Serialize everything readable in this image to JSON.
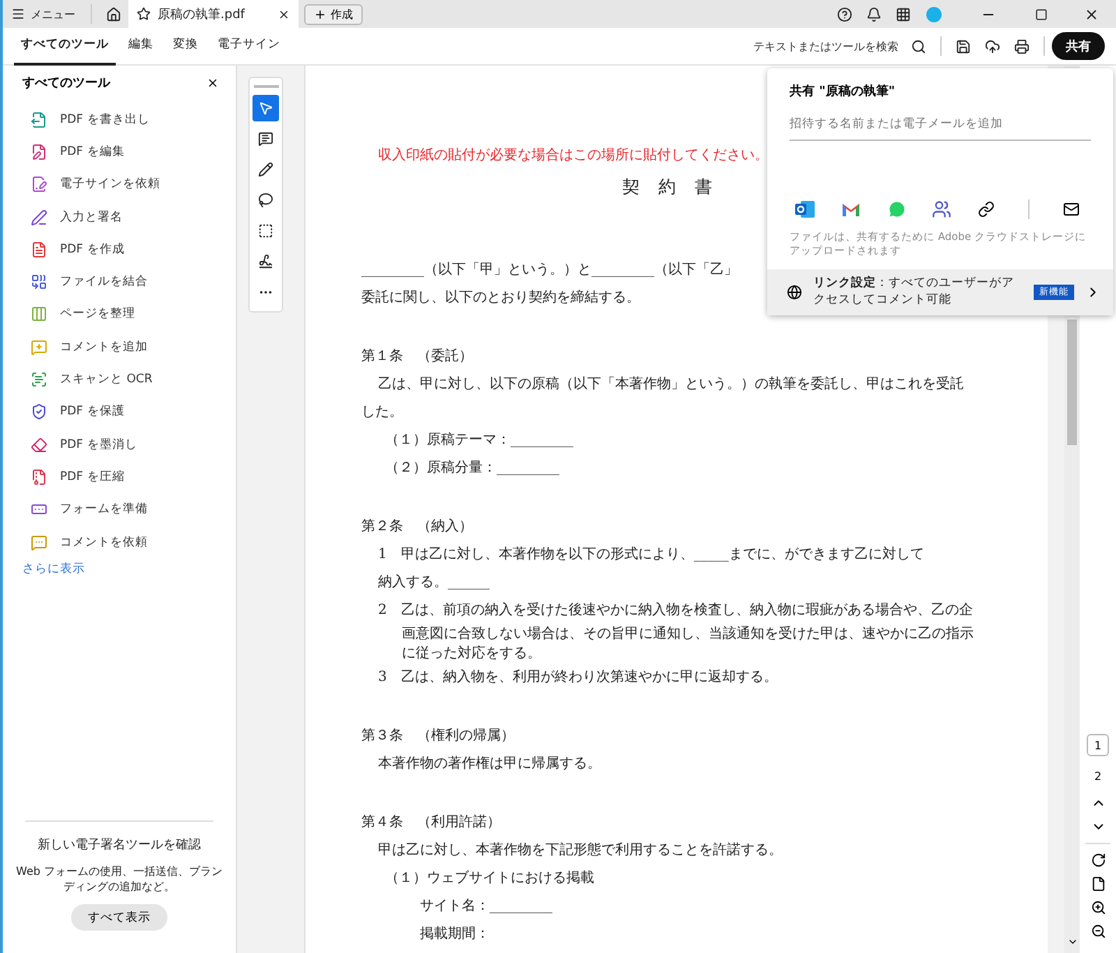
{
  "titlebar": {
    "menu": "メニュー",
    "tab": {
      "title": "原稿の執筆.pdf"
    },
    "create": "作成"
  },
  "toolbar": {
    "tabs": [
      {
        "label": "すべてのツール",
        "selected": true
      },
      {
        "label": "編集",
        "selected": false
      },
      {
        "label": "変換",
        "selected": false
      },
      {
        "label": "電子サイン",
        "selected": false
      }
    ],
    "search": "テキストまたはツールを検索",
    "share": "共有"
  },
  "sidebar": {
    "title": "すべてのツール",
    "items": [
      {
        "label": "PDF を書き出し",
        "color": "#1a9a8f"
      },
      {
        "label": "PDF を編集",
        "color": "#d0337a"
      },
      {
        "label": "電子サインを依頼",
        "color": "#b04ad0"
      },
      {
        "label": "入力と署名",
        "color": "#7a45d8"
      },
      {
        "label": "PDF を作成",
        "color": "#e03a3a"
      },
      {
        "label": "ファイルを結合",
        "color": "#4b5ee0"
      },
      {
        "label": "ページを整理",
        "color": "#7cb342"
      },
      {
        "label": "コメントを追加",
        "color": "#d8aa00"
      },
      {
        "label": "スキャンと OCR",
        "color": "#2ea04a"
      },
      {
        "label": "PDF を保護",
        "color": "#4b4bd8"
      },
      {
        "label": "PDF を墨消し",
        "color": "#d6246e"
      },
      {
        "label": "PDF を圧縮",
        "color": "#d93a50"
      },
      {
        "label": "フォームを準備",
        "color": "#8b48d0"
      },
      {
        "label": "コメントを依頼",
        "color": "#c99a00"
      }
    ],
    "more": "さらに表示",
    "promo": {
      "title": "新しい電子署名ツールを確認",
      "text": "Web フォームの使用、一括送信、ブランディングの追加など。",
      "button": "すべて表示"
    }
  },
  "tools": [
    {
      "kind": "select",
      "selected": true
    },
    {
      "kind": "comment",
      "selected": false
    },
    {
      "kind": "pen",
      "selected": false
    },
    {
      "kind": "lasso",
      "selected": false
    },
    {
      "kind": "textbox",
      "selected": false
    },
    {
      "kind": "sign",
      "selected": false
    },
    {
      "kind": "more",
      "selected": false
    }
  ],
  "document": {
    "lines": [
      {
        "kind": "note",
        "text": "収入印紙の貼付が必要な場合はこの場所に貼付してください。"
      },
      {
        "kind": "title",
        "text": "契　約　書"
      },
      {
        "kind": "line",
        "text": "_________（以下「甲」という。）と_________（以下「乙」"
      },
      {
        "kind": "line",
        "text": "委託に関し、以下のとおり契約を締結する。"
      },
      {
        "kind": "heading",
        "text": "第１条　（委託）"
      },
      {
        "kind": "indent",
        "text": "乙は、甲に対し、以下の原稿（以下「本著作物」という。）の執筆を委託し、甲はこれを受託"
      },
      {
        "kind": "line",
        "text": "した。"
      },
      {
        "kind": "item",
        "text": "（１）原稿テーマ：_________"
      },
      {
        "kind": "item",
        "text": "（２）原稿分量：_________"
      },
      {
        "kind": "heading",
        "text": "第２条　（納入）"
      },
      {
        "kind": "indent",
        "text": "1　甲は乙に対し、本著作物を以下の形式により、_____までに、ができます乙に対して"
      },
      {
        "kind": "indent",
        "text": "納入する。______"
      },
      {
        "kind": "indent",
        "text": "2　乙は、前項の納入を受けた後速やかに納入物を検査し、納入物に瑕疵がある場合や、乙の企"
      },
      {
        "kind": "hang",
        "text": "画意図に合致しない場合は、その旨甲に通知し、当該通知を受けた甲は、速やかに乙の指示"
      },
      {
        "kind": "hang",
        "text": "に従った対応をする。"
      },
      {
        "kind": "indent",
        "text": "3　乙は、納入物を、利用が終わり次第速やかに甲に返却する。"
      },
      {
        "kind": "heading",
        "text": "第３条　（権利の帰属）"
      },
      {
        "kind": "indent",
        "text": "本著作物の著作権は甲に帰属する。"
      },
      {
        "kind": "heading",
        "text": "第４条　（利用許諾）"
      },
      {
        "kind": "indent",
        "text": "甲は乙に対し、本著作物を下記形態で利用することを許諾する。"
      },
      {
        "kind": "item",
        "text": "（１）ウェブサイトにおける掲載"
      },
      {
        "kind": "sub",
        "text": "サイト名：_________"
      },
      {
        "kind": "sub",
        "text": "掲載期間："
      }
    ]
  },
  "pages": [
    {
      "label": "1",
      "selected": true
    },
    {
      "label": "2",
      "selected": false
    }
  ],
  "share_popup": {
    "title": "共有 \"原稿の執筆\"",
    "placeholder": "招待する名前または電子メールを追加",
    "note": "ファイルは、共有するために Adobe クラウドストレージにアップロードされます",
    "link_setting": "**リンク設定**：すべてのユーザーがアクセスしてコメント可能",
    "badge": "新機能"
  }
}
